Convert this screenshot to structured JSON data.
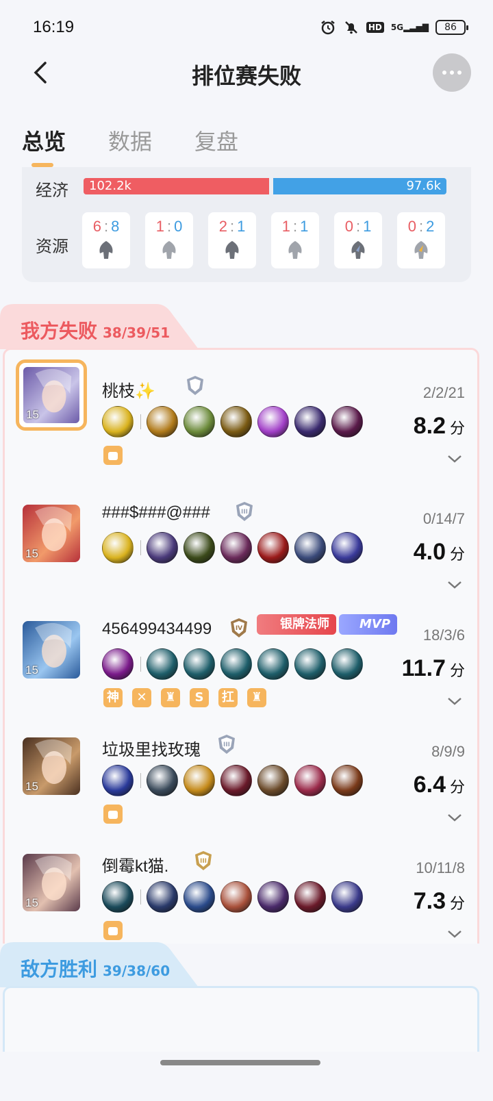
{
  "status": {
    "time": "16:19",
    "network": "5G",
    "hd": "HD",
    "battery": "86"
  },
  "header": {
    "title": "排位赛失败"
  },
  "tabs": [
    {
      "label": "总览",
      "active": true
    },
    {
      "label": "数据",
      "active": false
    },
    {
      "label": "复盘",
      "active": false
    }
  ],
  "overview": {
    "economy_label": "经济",
    "economy_ours": "102.2k",
    "economy_theirs": "97.6k",
    "economy_ours_fraction": 0.512,
    "resources_label": "资源",
    "resources": [
      {
        "ours": "6",
        "theirs": "8",
        "icon": "tyrant-icon"
      },
      {
        "ours": "1",
        "theirs": "0",
        "icon": "shadow-tyrant-icon"
      },
      {
        "ours": "2",
        "theirs": "1",
        "icon": "overlord-icon"
      },
      {
        "ours": "1",
        "theirs": "1",
        "icon": "dark-overlord-icon"
      },
      {
        "ours": "0",
        "theirs": "1",
        "icon": "storm-dragon-icon"
      },
      {
        "ours": "0",
        "theirs": "2",
        "icon": "fire-dragon-icon"
      }
    ],
    "separator": ":"
  },
  "our_team": {
    "title": "我方失败",
    "kda": "38/39/51",
    "color": "#ec5a5f",
    "players": [
      {
        "name": "桃枝✨",
        "level": "15",
        "kda": "2/2/21",
        "score": "8.2",
        "score_unit": "分",
        "rank_icon": "rank-silver-shield-icon",
        "highlight": true,
        "items": [
          "#d9b21e",
          "#b07a1a",
          "#6b8a3a",
          "#7a5a12",
          "#a13fc7",
          "#3a2a6e",
          "#5a1a4a"
        ],
        "tags": [
          "fist-tag-icon"
        ],
        "honors": []
      },
      {
        "name": "###$###@###",
        "level": "15",
        "kda": "0/14/7",
        "score": "4.0",
        "score_unit": "分",
        "rank_icon": "rank-silver-shield-icon",
        "highlight": false,
        "items": [
          "#d9b21e",
          "#4a3a7a",
          "#3b4a1a",
          "#6a2a5a",
          "#9a1a1a",
          "#3a4a7a",
          "#3a3a9a"
        ],
        "tags": [],
        "honors": []
      },
      {
        "name": "456499434499",
        "level": "15",
        "kda": "18/3/6",
        "score": "11.7",
        "score_unit": "分",
        "rank_icon": "rank-bronze-iv-icon",
        "highlight": false,
        "items": [
          "#7a1a8a",
          "#1e5e6a",
          "#1e5e6a",
          "#1e5e6a",
          "#1e5e6a",
          "#1e5e6a",
          "#1e5e6a"
        ],
        "tags": [
          "神",
          "✕",
          "♜",
          "S",
          "扛",
          "♜"
        ],
        "honors": [
          {
            "label": "银牌法师",
            "style": "silver"
          },
          {
            "label": "MVP",
            "style": "mvp"
          }
        ]
      },
      {
        "name": "垃圾里找玫瑰",
        "level": "15",
        "kda": "8/9/9",
        "score": "6.4",
        "score_unit": "分",
        "rank_icon": "rank-silver-shield-icon",
        "highlight": false,
        "items": [
          "#2a3a9a",
          "#3a4a5a",
          "#c48a1a",
          "#6a1a2a",
          "#6a4a2a",
          "#9a2a4a",
          "#7a3a1a"
        ],
        "tags": [
          "castle-tag-icon"
        ],
        "honors": []
      },
      {
        "name": "倒霉kt猫.",
        "level": "15",
        "kda": "10/11/8",
        "score": "7.3",
        "score_unit": "分",
        "rank_icon": "rank-gold-iii-icon",
        "highlight": false,
        "items": [
          "#1a4a5a",
          "#2a3a6a",
          "#2a4a8a",
          "#a8503a",
          "#4a2a6a",
          "#6a1a2a",
          "#3a3a8a"
        ],
        "tags": [
          "shield-tag-icon"
        ],
        "honors": []
      }
    ]
  },
  "enemy_team": {
    "title": "敌方胜利",
    "kda": "39/38/60",
    "color": "#3d9be0"
  }
}
